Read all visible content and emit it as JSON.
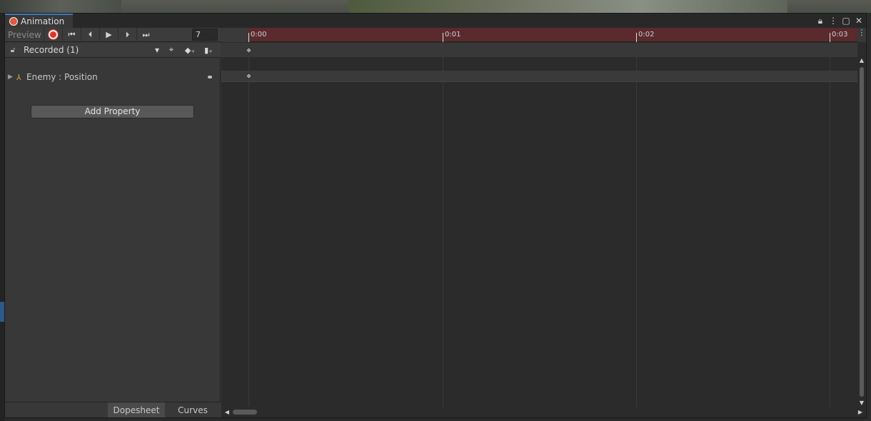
{
  "window": {
    "tab_title": "Animation",
    "controls": [
      "lock-icon",
      "menu-icon",
      "maximize-icon",
      "close-icon"
    ]
  },
  "toolbar": {
    "preview_label": "Preview",
    "record_icon": "record-icon",
    "buttons": [
      "first-key-icon",
      "prev-key-icon",
      "play-icon",
      "next-key-icon",
      "last-key-icon"
    ],
    "current_frame": "7"
  },
  "clip": {
    "selected": "Recorded (1)",
    "tools": [
      "filter-by-selection-icon",
      "add-keyframe-icon",
      "add-event-icon"
    ]
  },
  "properties": [
    {
      "object": "Enemy",
      "property": "Position",
      "label": "Enemy : Position"
    }
  ],
  "add_property_label": "Add Property",
  "bottom_tabs": {
    "dopesheet": "Dopesheet",
    "curves": "Curves",
    "active": "Dopesheet"
  },
  "ruler": {
    "ticks": [
      "0:00",
      "0:01",
      "0:02",
      "0:03"
    ]
  },
  "colors": {
    "ruler_bg": "#5a2a2d",
    "record_red": "#e0352b",
    "tab_accent": "#3a79bb"
  }
}
